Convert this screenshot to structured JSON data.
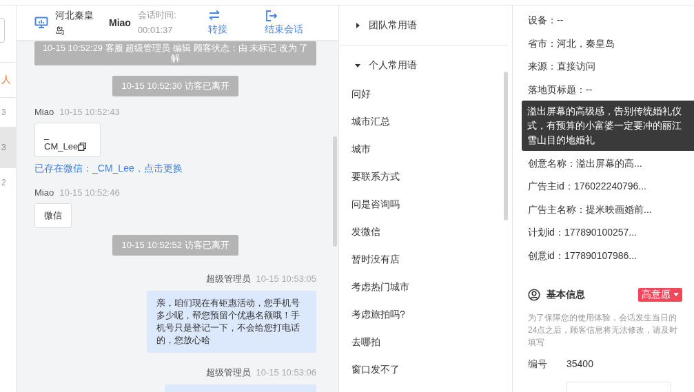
{
  "sliver": [
    {
      "text": "人",
      "kind": "accent"
    },
    {
      "text": "3",
      "selected": false
    },
    {
      "text": "3",
      "selected": true
    },
    {
      "text": "2",
      "selected": false
    }
  ],
  "chat_header": {
    "location": "河北秦皇岛",
    "visitor": "Miao",
    "duration_label": "会话时间:",
    "duration": "00:01:37",
    "actions": [
      {
        "label": "转接",
        "kind": "transfer"
      },
      {
        "label": "结束会话",
        "kind": "end"
      }
    ]
  },
  "messages": [
    {
      "kind": "status",
      "text": "10-15 10:52:29 客服 超级管理员 编辑 顾客状态：由 未标记 改为 了解"
    },
    {
      "kind": "system",
      "text": "10-15 10:52:30 访客已离开"
    },
    {
      "kind": "visitor",
      "sender": "Miao",
      "time": "10-15 10:52:43",
      "card": [
        "_",
        "CM_Lee"
      ]
    },
    {
      "kind": "link",
      "text": "已存在微信：_CM_Lee，点击更换"
    },
    {
      "kind": "visitor",
      "sender": "Miao",
      "time": "10-15 10:52:46",
      "text": "微信"
    },
    {
      "kind": "system",
      "text": "10-15 10:52:52 访客已离开"
    },
    {
      "kind": "agent",
      "sender": "超级管理员",
      "time": "10-15 10:53:05",
      "text": "亲，咱们现在有钜惠活动，您手机号多少呢，帮您预留个优惠名额哦！手机号只是登记一下，不会给您打电话的，您放心哈"
    },
    {
      "kind": "agent",
      "sender": "超级管理员",
      "time": "10-15 10:53:06"
    }
  ],
  "phrase_groups": [
    {
      "label": "团队常用语",
      "expanded": false
    },
    {
      "label": "个人常用语",
      "expanded": true,
      "children": [
        "问好",
        "城市汇总",
        "城市",
        "要联系方式",
        "问是咨询吗",
        "发微信",
        "暂时没有店",
        "考虑热门城市",
        "考虑旅拍吗?",
        "去哪拍",
        "窗口发不了"
      ]
    }
  ],
  "visitor_info": [
    {
      "text": "设备：--"
    },
    {
      "text": "省市：河北，秦皇岛"
    },
    {
      "text": "来源：直接访问"
    },
    {
      "text": "落地页标题：--"
    },
    {
      "text": "创意名称：溢出屏幕的高...",
      "tooltip": "溢出屏幕的高级感，告别传统婚礼仪式，有预算的小富婆一定要冲的丽江雪山目的地婚礼"
    },
    {
      "text": "广告主id：176022240796..."
    },
    {
      "text": "广告主名称：提米映画婚前..."
    },
    {
      "text": "计划id：177890100257..."
    },
    {
      "text": "创意id：177890107986..."
    }
  ],
  "basic_info": {
    "title": "基本信息",
    "intent": "高意愿",
    "note": "为了保障您的使用体验，会话发生当日的24点之后，顾客信息将无法修改，请及时填写",
    "fields": [
      {
        "label": "编号",
        "value": "35400"
      }
    ]
  }
}
